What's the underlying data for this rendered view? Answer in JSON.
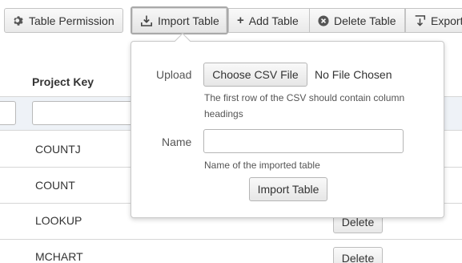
{
  "toolbar": {
    "table_permission": "Table Permission",
    "import_table": "Import Table",
    "add_table": "Add Table",
    "delete_table": "Delete Table",
    "export": "Export"
  },
  "table": {
    "column_header": "Project Key",
    "rows": [
      {
        "key": "COUNTJ"
      },
      {
        "key": "COUNT"
      },
      {
        "key": "LOOKUP",
        "action": "Delete"
      },
      {
        "key": "MCHART",
        "action": "Delete"
      }
    ]
  },
  "import_popover": {
    "upload_label": "Upload",
    "choose_file_button": "Choose CSV File",
    "file_status": "No File Chosen",
    "upload_help": "The first row of the CSV should contain column headings",
    "name_label": "Name",
    "name_value": "",
    "name_help": "Name of the imported table",
    "submit_button": "Import Table"
  }
}
